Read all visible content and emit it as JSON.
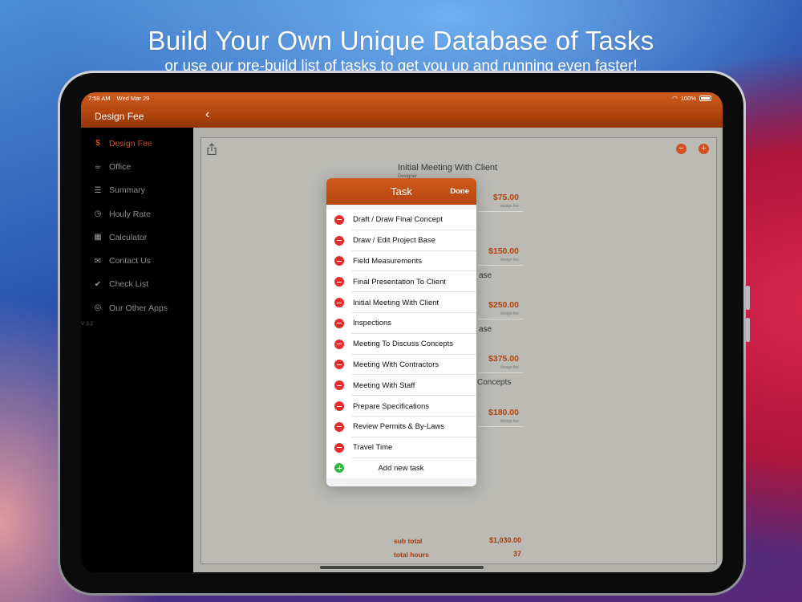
{
  "banner": {
    "headline": "Build Your Own Unique Database of Tasks",
    "subline": "or use our pre-build list of tasks to get you up and running even faster!"
  },
  "status_bar": {
    "time": "7:58 AM",
    "date": "Wed Mar 29",
    "battery": "100%"
  },
  "app": {
    "title": "Design Fee",
    "accent_color": "#d1501c"
  },
  "sidebar": {
    "items": [
      {
        "label": "Design Fee",
        "icon": "dollar-icon",
        "active": true
      },
      {
        "label": "Office",
        "icon": "coffee-icon"
      },
      {
        "label": "Summary",
        "icon": "list-icon"
      },
      {
        "label": "Houly Rate",
        "icon": "clock-icon"
      },
      {
        "label": "Calculator",
        "icon": "calculator-icon"
      },
      {
        "label": "Contact Us",
        "icon": "mail-icon"
      },
      {
        "label": "Check List",
        "icon": "check-icon"
      },
      {
        "label": "Our Other Apps",
        "icon": "apps-icon"
      }
    ],
    "version": "V 3.2"
  },
  "main": {
    "first_item_title": "Initial Meeting With Client",
    "first_item_sub": "Designer",
    "prices": [
      "$75.00",
      "$150.00",
      "$250.00",
      "$375.00",
      "$180.00"
    ],
    "price_note": "design fee",
    "partial_texts": [
      "ase",
      "ase",
      "Concepts"
    ],
    "totals": {
      "sub_total_label": "sub total",
      "sub_total_value": "$1,030.00",
      "total_hours_label": "total hours",
      "total_hours_value": "37"
    }
  },
  "modal": {
    "title": "Task",
    "done_label": "Done",
    "tasks": [
      "Draft / Draw Final Concept",
      "Draw / Edit Project Base",
      "Field Measurements",
      "Final Presentation To Client",
      "Initial Meeting With Client",
      "Inspections",
      "Meeting To Discuss Concepts",
      "Meeting With Contractors",
      "Meeting With Staff",
      "Prepare Specifications",
      "Review Permits & By-Laws",
      "Travel Time"
    ],
    "add_label": "Add new task"
  }
}
